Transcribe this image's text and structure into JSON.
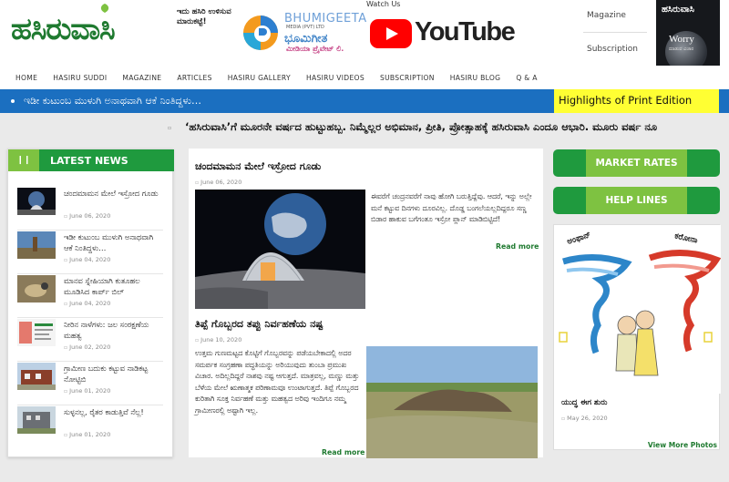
{
  "header": {
    "logo_text": "ಹಸಿರುವಾಸಿ",
    "logo_tagline": "ಇದು ಹಸಿರಿ ಉಳಿಸುವ ಮಾರುಕಟ್ಟೆ!",
    "bhumigeeta_en": "BHUMIGEETA",
    "bhumigeeta_sub": "MEDIA (PVT) LTD",
    "bhumigeeta_kn": "ಭೂಮಿಗೀತ",
    "bhumigeeta_kn2": "ಮೀಡಿಯಾ ಪ್ರೈವೇಟ್ ಲಿ.",
    "watch_us": "Watch Us",
    "youtube_word": "YouTube",
    "magazine_link": "Magazine",
    "subscription_link": "Subscription",
    "cover_title": "ಹಸಿರುವಾಸಿ",
    "cover_headline": "Worry",
    "cover_sub": "ಮಾಡುವ ವಿಚಾರ"
  },
  "nav": [
    "HOME",
    "HASIRU SUDDI",
    "MAGAZINE",
    "ARTICLES",
    "HASIRU GALLERY",
    "HASIRU VIDEOS",
    "SUBSCRIPTION",
    "HASIRU BLOG",
    "Q & A"
  ],
  "ticker": {
    "text": "ಇಡೀ ಕುಟುಂಬ ಮುಳುಗಿ ಅನಾಥವಾಗಿ ಆಕೆ ನಿಂತಿದ್ದಳು…",
    "highlights": "Highlights of Print Edition"
  },
  "marquee": "‘ಹಸಿರುವಾಸಿ’ಗೆ ಮೂರನೇ ವರ್ಷದ ಹುಟ್ಟುಹಬ್ಬ. ನಿಮ್ಮೆಲ್ಲರ ಅಭಿಮಾನ, ಪ್ರೀತಿ, ಪ್ರೋತ್ಸಾಹಕ್ಕೆ ಹಸಿರುವಾಸಿ ಎಂದೂ ಆಭಾರಿ. ಮೂರು ವರ್ಷ ನೂ",
  "latest": {
    "title": "LATEST NEWS",
    "items": [
      {
        "title": "ಚಂದಮಾಮನ ಮೇಲೆ ಇಸ್ರೋದ ಗೂಡು",
        "date": "June 06, 2020"
      },
      {
        "title": "ಇಡೀ ಕುಟುಂಬ ಮುಳುಗಿ ಅನಾಥವಾಗಿ ಆಕೆ ನಿಂತಿದ್ದಳು…",
        "date": "June 04, 2020"
      },
      {
        "title": "ಮಾನವ ಸ್ನೇಹಿಯಾಗಿ ಕುತೂಹಲ ಮೂಡಿಸಿದ ಕಾರ್ಪ್ ಬಿಲ್",
        "date": "June 04, 2020"
      },
      {
        "title": "ನೀರಿನ ನಾಳೆಗಳು: ಜಲ ಸಂರಕ್ಷಣೆಯ ಮಹತ್ವ",
        "date": "June 02, 2020"
      },
      {
        "title": "ಗ್ರಾಮೀಣ ಬದುಕು ಕಟ್ಟುವ ನಾಡಿಕಟ್ಟ ನೋಟ್ಟಿಬಿ",
        "date": "June 01, 2020"
      },
      {
        "title": "ಸುಳ್ಳನಲ್ಲ, ರೈತರ ಕಾಡುತ್ತಿವೆ ನೆಲ್ಲ!",
        "date": "June 01, 2020"
      }
    ]
  },
  "articles": [
    {
      "title": "ಚಂದಮಾಮನ ಮೇಲೆ ಇಸ್ರೋದ ಗೂಡು",
      "date": "June 06, 2020",
      "excerpt": "ಈವರೆಗೆ ಚಂದ್ರನವರೆಗೆ ನಾವು ಹೋಗಿ ಬರುತ್ತಿದ್ದೆವು. ಆದರೆ, ಇನ್ನು ಅಲ್ಲೇ ಮನೆ ಕಟ್ಟುವ ದಿನಗಳು ದೂರವಿಲ್ಲ. ದೊಡ್ಡ ಬಂಗಲೆಯಲ್ಲದಿದ್ದರೂ ಸಣ್ಣ ಬಿಡಾರ ಹಾಕುವ ಬಗೆಗಂತೂ ಇಸ್ರೋ ಪ್ಲಾನ್ ಮಾಡಿಬಿಟ್ಟಿದೆ!",
      "read_more": "Read more"
    },
    {
      "title": "ತಿಪ್ಪೆ ಗೊಬ್ಬರದ ತಪ್ಪು ನಿರ್ವಹಣೆಯ ನಷ್ಟ",
      "date": "June 10, 2020",
      "excerpt": "ಉತ್ತಮ ಗುಣಮಟ್ಟದ ಕೊಟ್ಟಿಗೆ ಗೊಬ್ಬರವನ್ನು ಪಡೆಯಬೇಕಾದಲ್ಲಿ ಅದರ ಸಮರ್ಪಕ ಸಂಗ್ರಹಣಾ ಪದ್ಧತಿಯನ್ನು ಅರಿಯುವುದು ತುಂಬಾ ಪ್ರಮುಖ ವಿಚಾರ. ಅದಿಲ್ಲದಿದ್ದರೆ ನಾಶವು ನಷ್ಟ ಆಗುತ್ತದೆ. ಮಾತ್ರವಲ್ಲ, ಮಣ್ಣು ಮತ್ತು ಬೆಳೆಯ ಮೇಲೆ ಋಣಾತ್ಮಕ ಪರಿಣಾಮವೂ ಉಂಟಾಗುತ್ತದೆ. ತಿಪ್ಪೆ ಗೊಬ್ಬರದ ಕುರಿತಾಗಿ ಸೂಕ್ತ ನಿರ್ವಹಣೆ ಮತ್ತು ಮಹತ್ವದ ಅರಿವು ಇಂದಿಗೂ ನಮ್ಮ ಗ್ರಾಮೀಣರಲ್ಲಿ ಅಷ್ಟಾಗಿ ಇಲ್ಲ.",
      "read_more": "Read more"
    }
  ],
  "right": {
    "market_rates": "MARKET RATES",
    "help_lines": "HELP LINES",
    "cartoon_label_left": "ಅಂಫಾನ್",
    "cartoon_label_right": "ಕರೋನಾ",
    "cartoon_title": "ಯುದ್ಧ ಈಗ ಶುರು",
    "cartoon_date": "May 26, 2020",
    "view_more": "View More Photos"
  },
  "colors": {
    "green": "#1f9a3e",
    "light_green": "#7ec241",
    "blue": "#1b6fc0",
    "yellow": "#ffff33"
  }
}
